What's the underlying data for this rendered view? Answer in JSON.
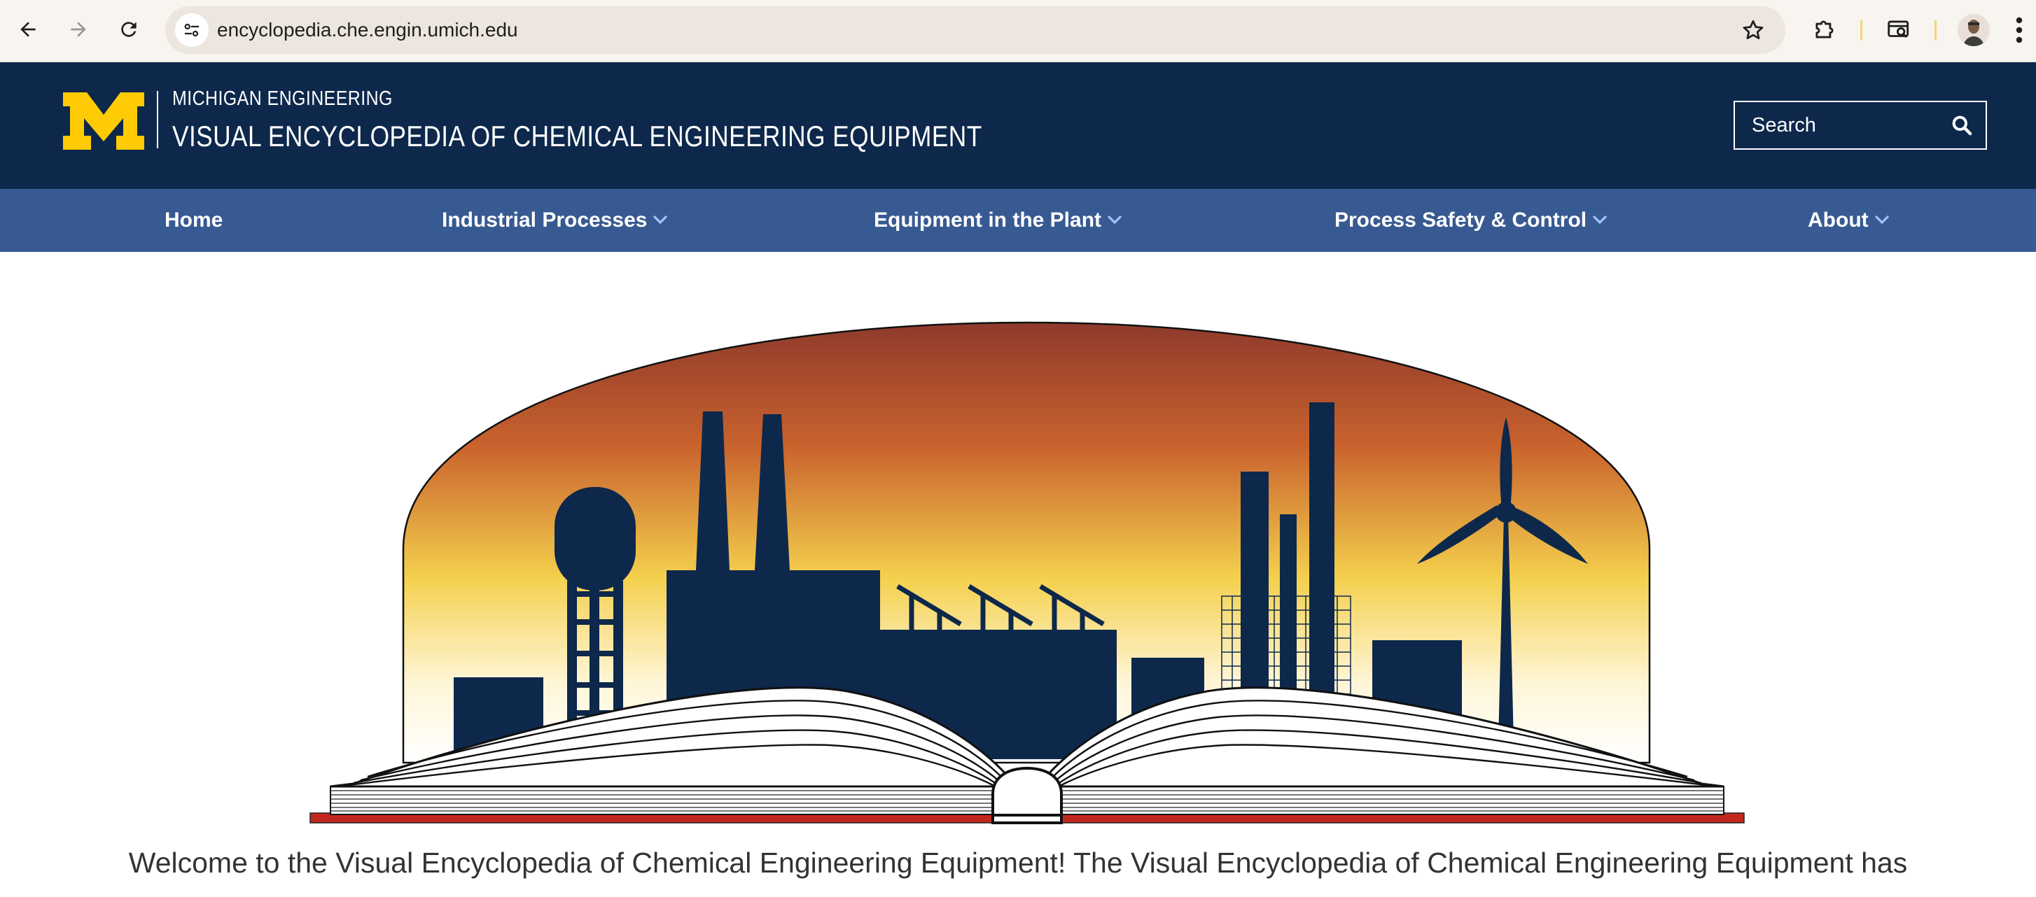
{
  "browser": {
    "url": "encyclopedia.che.engin.umich.edu",
    "icons": [
      "back-arrow-icon",
      "forward-arrow-icon",
      "reload-icon",
      "site-info-icon",
      "bookmark-star-icon",
      "extensions-puzzle-icon",
      "tab-search-icon",
      "profile-avatar",
      "more-menu-icon"
    ]
  },
  "header": {
    "org": "MICHIGAN ENGINEERING",
    "title": "VISUAL ENCYCLOPEDIA OF CHEMICAL ENGINEERING EQUIPMENT",
    "search_placeholder": "Search",
    "colors": {
      "navy": "#0d284b",
      "maize": "#ffcb05",
      "nav_blue": "#385a92"
    }
  },
  "nav": {
    "items": [
      {
        "label": "Home",
        "has_dropdown": false
      },
      {
        "label": "Industrial Processes",
        "has_dropdown": true
      },
      {
        "label": "Equipment in the Plant",
        "has_dropdown": true
      },
      {
        "label": "Process Safety & Control",
        "has_dropdown": true
      },
      {
        "label": "About",
        "has_dropdown": true
      }
    ]
  },
  "main": {
    "welcome_text": "Welcome to the Visual Encyclopedia of Chemical Engineering Equipment! The Visual Encyclopedia of Chemical Engineering Equipment has"
  }
}
